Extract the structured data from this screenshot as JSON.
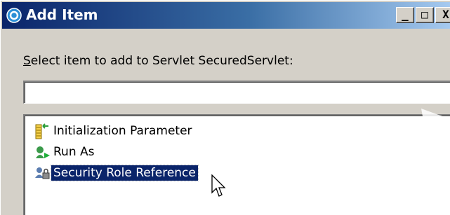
{
  "window": {
    "title": "Add Item",
    "icon": "eclipse-dialog-icon",
    "controls": {
      "minimize": "_",
      "maximize": "□",
      "close": "X"
    }
  },
  "prompt": {
    "mnemonic": "S",
    "rest": "elect item to add to Servlet SecuredServlet:"
  },
  "filter": {
    "value": "",
    "placeholder": ""
  },
  "items": [
    {
      "label": "Initialization Parameter",
      "icon": "init-parameter-icon",
      "selected": false
    },
    {
      "label": "Run As",
      "icon": "run-as-icon",
      "selected": false
    },
    {
      "label": "Security Role Reference",
      "icon": "security-role-reference-icon",
      "selected": true
    }
  ],
  "colors": {
    "titlebar_start": "#0a246a",
    "titlebar_end": "#a6caf0",
    "selection": "#0a246a"
  }
}
